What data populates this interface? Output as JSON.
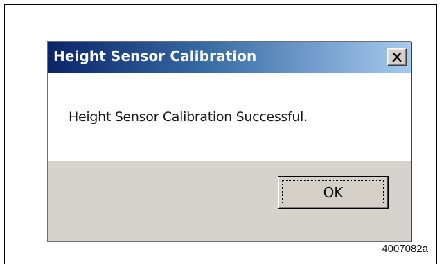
{
  "figure": {
    "id": "4007082a"
  },
  "dialog": {
    "title": "Height Sensor Calibration",
    "message": "Height Sensor Calibration Successful.",
    "ok_label": "OK",
    "close_icon": "close-icon"
  },
  "colors": {
    "titlebar_start": "#0a246a",
    "titlebar_end": "#a6caf0",
    "dialog_background": "#d6d3ce",
    "content_background": "#ffffff"
  }
}
